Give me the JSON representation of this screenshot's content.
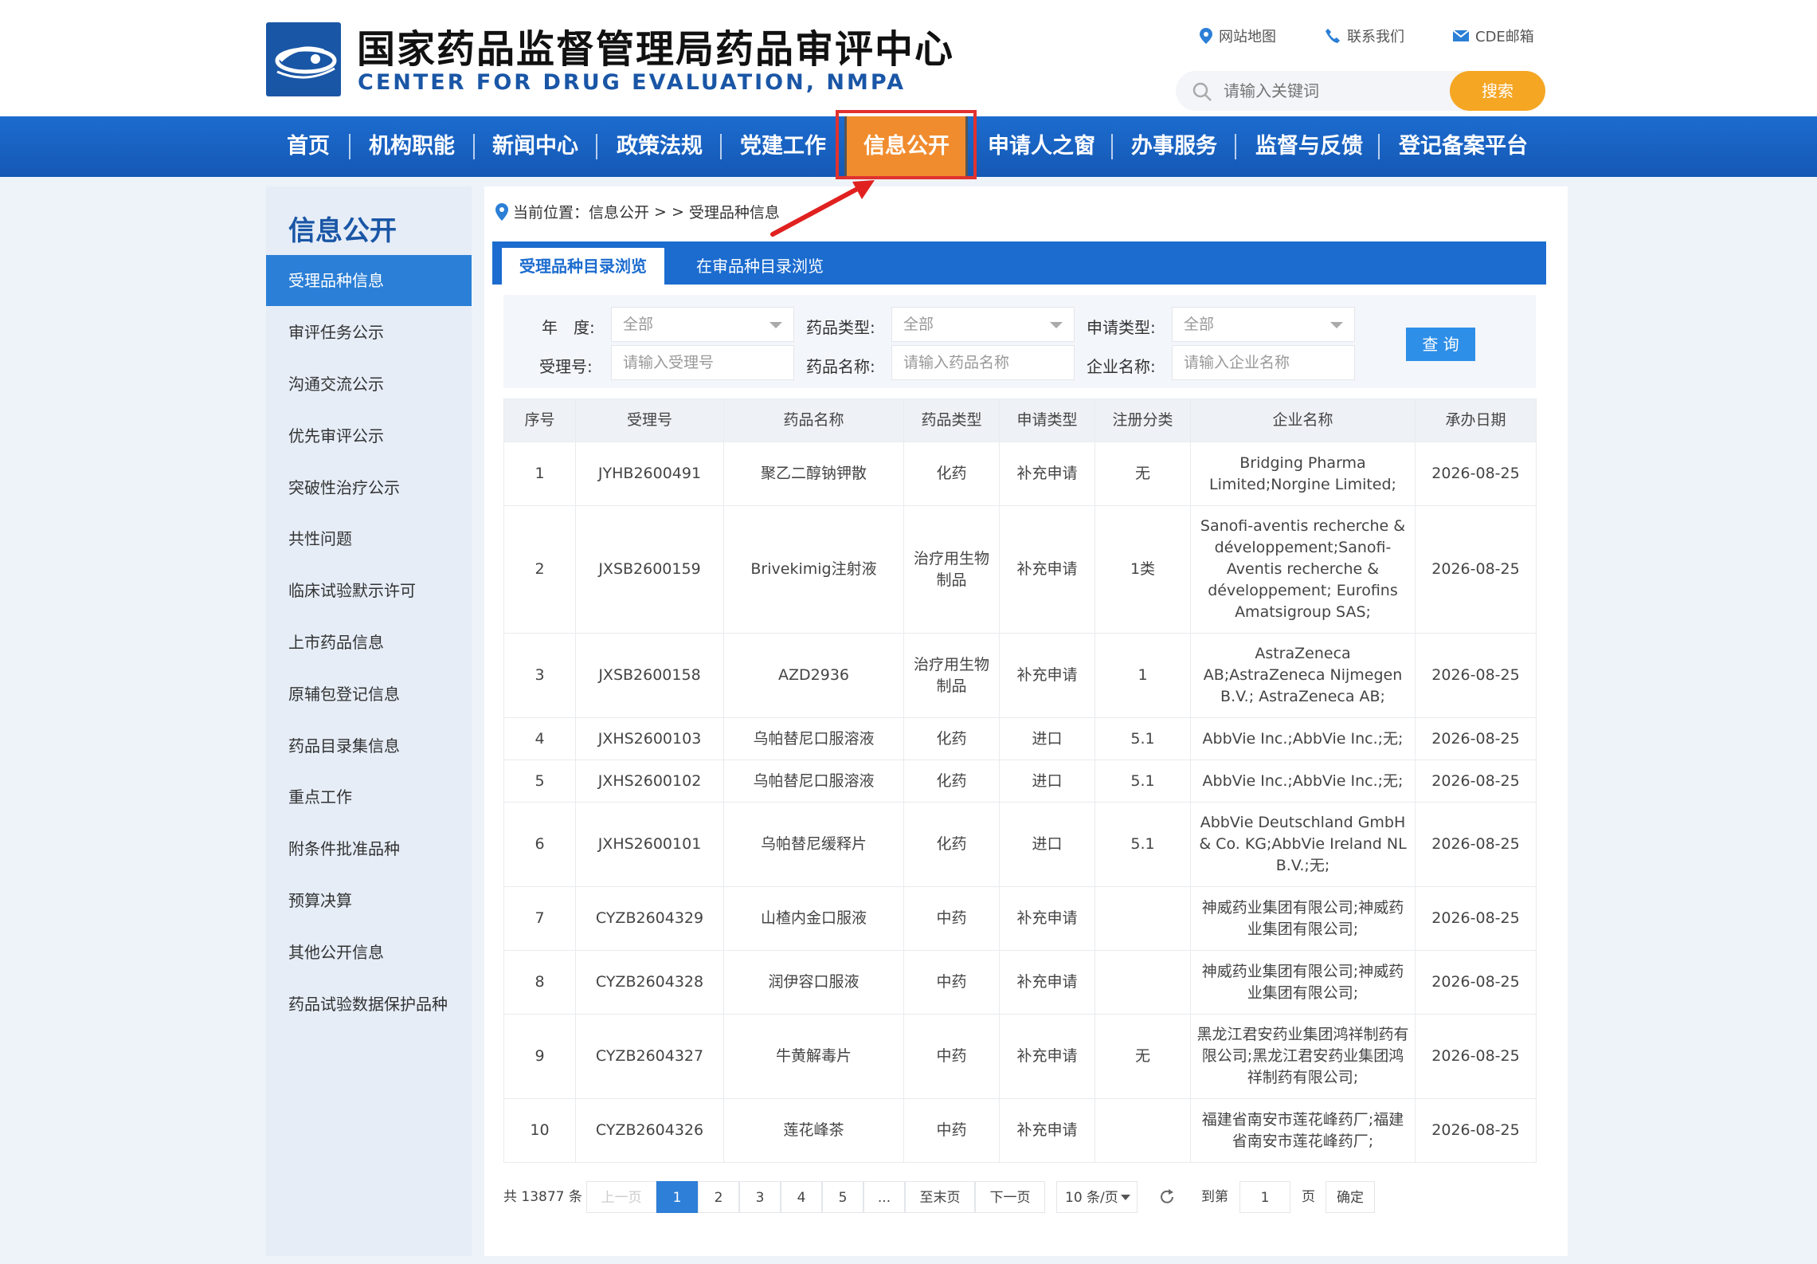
{
  "header": {
    "title": "国家药品监督管理局药品审评中心",
    "subtitle": "CENTER FOR DRUG EVALUATION, NMPA",
    "links": [
      "网站地图",
      "联系我们",
      "CDE邮箱"
    ],
    "search_placeholder": "请输入关键词",
    "search_button": "搜索"
  },
  "nav": {
    "items": [
      "首页",
      "机构职能",
      "新闻中心",
      "政策法规",
      "党建工作",
      "信息公开",
      "申请人之窗",
      "办事服务",
      "监督与反馈",
      "登记备案平台"
    ],
    "active": "信息公开"
  },
  "sidebar": {
    "title": "信息公开",
    "items": [
      "受理品种信息",
      "审评任务公示",
      "沟通交流公示",
      "优先审评公示",
      "突破性治疗公示",
      "共性问题",
      "临床试验默示许可",
      "上市药品信息",
      "原辅包登记信息",
      "药品目录集信息",
      "重点工作",
      "附条件批准品种",
      "预算决算",
      "其他公开信息",
      "药品试验数据保护品种"
    ],
    "active": "受理品种信息"
  },
  "breadcrumb": {
    "prefix": "当前位置：信息公开",
    "sep": "> >",
    "current": "受理品种信息"
  },
  "tabs": [
    "受理品种目录浏览",
    "在审品种目录浏览"
  ],
  "filters": {
    "year_label": "年　度:",
    "year_value": "全部",
    "type_label": "药品类型:",
    "type_value": "全部",
    "apply_label": "申请类型:",
    "apply_value": "全部",
    "accept_label": "受理号:",
    "accept_placeholder": "请输入受理号",
    "name_label": "药品名称:",
    "name_placeholder": "请输入药品名称",
    "company_label": "企业名称:",
    "company_placeholder": "请输入企业名称",
    "query_button": "查 询"
  },
  "table": {
    "headers": [
      "序号",
      "受理号",
      "药品名称",
      "药品类型",
      "申请类型",
      "注册分类",
      "企业名称",
      "承办日期"
    ],
    "rows": [
      [
        "1",
        "JYHB2600491",
        "聚乙二醇钠钾散",
        "化药",
        "补充申请",
        "无",
        "Bridging Pharma Limited;Norgine Limited;",
        "2026-08-25"
      ],
      [
        "2",
        "JXSB2600159",
        "Brivekimig注射液",
        "治疗用生物制品",
        "补充申请",
        "1类",
        "Sanofi-aventis recherche & développement;Sanofi-Aventis recherche & développement; Eurofins Amatsigroup SAS;",
        "2026-08-25"
      ],
      [
        "3",
        "JXSB2600158",
        "AZD2936",
        "治疗用生物制品",
        "补充申请",
        "1",
        "AstraZeneca AB;AstraZeneca Nijmegen B.V.; AstraZeneca AB;",
        "2026-08-25"
      ],
      [
        "4",
        "JXHS2600103",
        "乌帕替尼口服溶液",
        "化药",
        "进口",
        "5.1",
        "AbbVie Inc.;AbbVie Inc.;无;",
        "2026-08-25"
      ],
      [
        "5",
        "JXHS2600102",
        "乌帕替尼口服溶液",
        "化药",
        "进口",
        "5.1",
        "AbbVie Inc.;AbbVie Inc.;无;",
        "2026-08-25"
      ],
      [
        "6",
        "JXHS2600101",
        "乌帕替尼缓释片",
        "化药",
        "进口",
        "5.1",
        "AbbVie Deutschland GmbH & Co. KG;AbbVie Ireland NL B.V.;无;",
        "2026-08-25"
      ],
      [
        "7",
        "CYZB2604329",
        "山楂内金口服液",
        "中药",
        "补充申请",
        "",
        "神威药业集团有限公司;神威药业集团有限公司;",
        "2026-08-25"
      ],
      [
        "8",
        "CYZB2604328",
        "润伊容口服液",
        "中药",
        "补充申请",
        "",
        "神威药业集团有限公司;神威药业集团有限公司;",
        "2026-08-25"
      ],
      [
        "9",
        "CYZB2604327",
        "牛黄解毒片",
        "中药",
        "补充申请",
        "无",
        "黑龙江君安药业集团鸿祥制药有限公司;黑龙江君安药业集团鸿祥制药有限公司;",
        "2026-08-25"
      ],
      [
        "10",
        "CYZB2604326",
        "莲花峰茶",
        "中药",
        "补充申请",
        "",
        "福建省南安市莲花峰药厂;福建省南安市莲花峰药厂;",
        "2026-08-25"
      ]
    ]
  },
  "pagination": {
    "total": "共 13877 条",
    "prev": "上一页",
    "pages": [
      "1",
      "2",
      "3",
      "4",
      "5",
      "..."
    ],
    "last": "至末页",
    "next": "下一页",
    "page_size": "10 条/页",
    "goto_label": "到第",
    "goto_value": "1",
    "page_unit": "页",
    "confirm": "确定"
  },
  "colors": {
    "nav_blue": "#1c6ccf",
    "nav_active": "#f08c2e",
    "highlight_red": "#e0322f",
    "search_orange": "#f5a623",
    "sidebar_active": "#2b7fd6"
  },
  "icons": [
    "map-pin-icon",
    "phone-icon",
    "mail-icon",
    "search-icon",
    "location-icon",
    "refresh-icon",
    "arrow-annotation"
  ]
}
